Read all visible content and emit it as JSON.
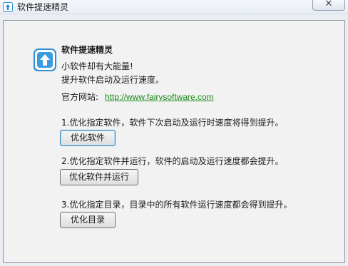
{
  "window": {
    "title": "软件提速精灵",
    "close_symbol": "✕"
  },
  "header": {
    "app_name": "软件提速精灵",
    "slogan_line1": "小软件却有大能量!",
    "slogan_line2": "提升软件启动及运行速度。",
    "site_label": "官方网站:",
    "site_url": "http://www.fairysoftware.com"
  },
  "steps": [
    {
      "text": "1.优化指定软件，软件下次启动及运行时速度将得到提升。",
      "button_label": "优化软件"
    },
    {
      "text": "2.优化指定软件并运行，软件的启动及运行速度都会提升。",
      "button_label": "优化软件并运行"
    },
    {
      "text": "3.优化指定目录，目录中的所有软件运行速度都会得到提升。",
      "button_label": "优化目录"
    }
  ],
  "colors": {
    "link": "#1d8a1d",
    "logo_blue": "#2f8fd6",
    "panel_bg": "#f2f2f2"
  },
  "icons": [
    "app-logo-icon",
    "close-icon"
  ]
}
